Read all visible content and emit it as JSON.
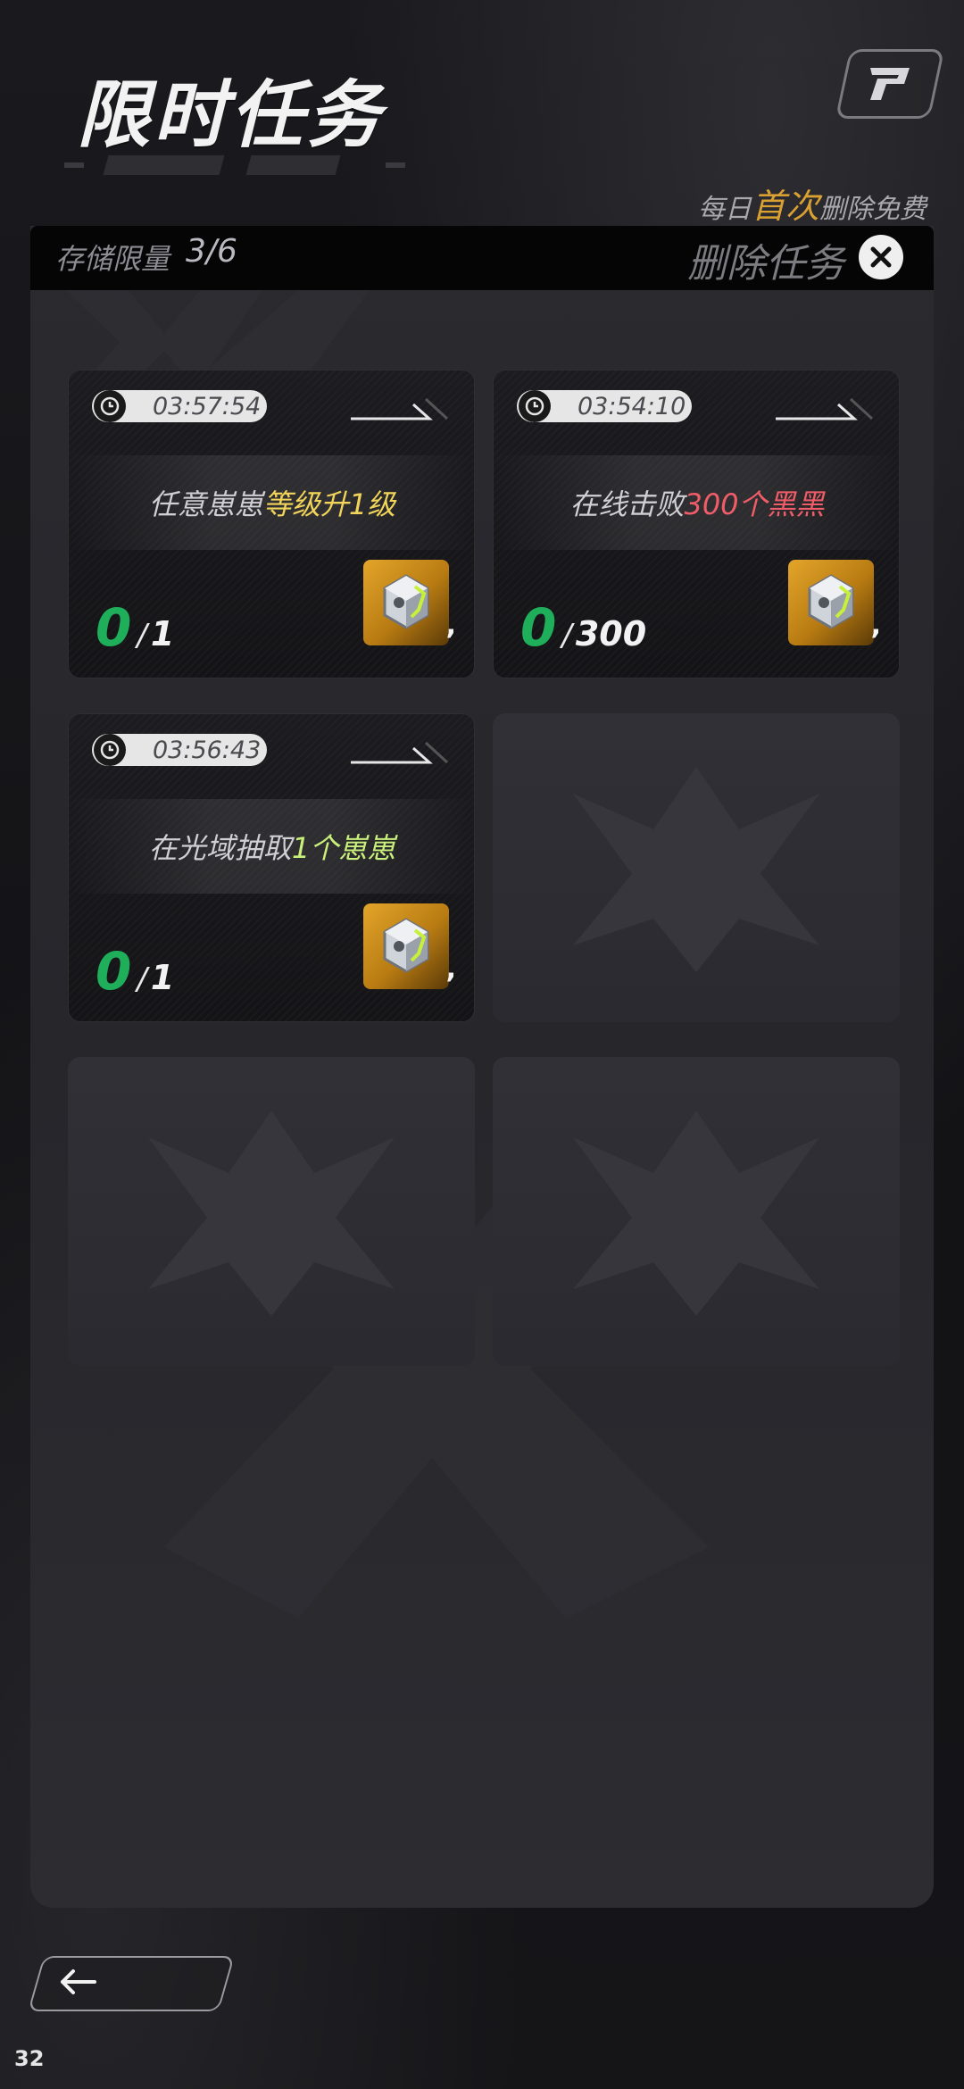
{
  "header": {
    "title": "限时任务"
  },
  "notice": {
    "prefix": "每日",
    "highlight": "首次",
    "suffix": "删除免费"
  },
  "panel": {
    "storage_label": "存储限量",
    "storage_value": "3/6",
    "delete_label": "删除任务"
  },
  "tasks": [
    {
      "timer": "03:57:54",
      "text_plain": "任意崽崽",
      "text_highlight": "等级升1级",
      "highlight_color": "#f2d45a",
      "progress_current": "0",
      "progress_total": "1",
      "reward_icon": "cube-crystal-icon",
      "reward_suffix": ","
    },
    {
      "timer": "03:54:10",
      "text_plain": "在线击败",
      "text_highlight": "300个黑黑",
      "highlight_color": "#f05d68",
      "progress_current": "0",
      "progress_total": "300",
      "reward_icon": "cube-crystal-icon",
      "reward_suffix": ","
    },
    {
      "timer": "03:56:43",
      "text_plain": "在光域抽取",
      "text_highlight": "1个崽崽",
      "highlight_color": "#c8f07a",
      "progress_current": "0",
      "progress_total": "1",
      "reward_icon": "cube-crystal-icon",
      "reward_suffix": ","
    }
  ],
  "empty_slots": 3,
  "footer": {
    "page_number": "32"
  },
  "colors": {
    "progress_current": "#1fae5a",
    "reward_bg": "#e3a52a",
    "free_highlight": "#d9a132"
  }
}
